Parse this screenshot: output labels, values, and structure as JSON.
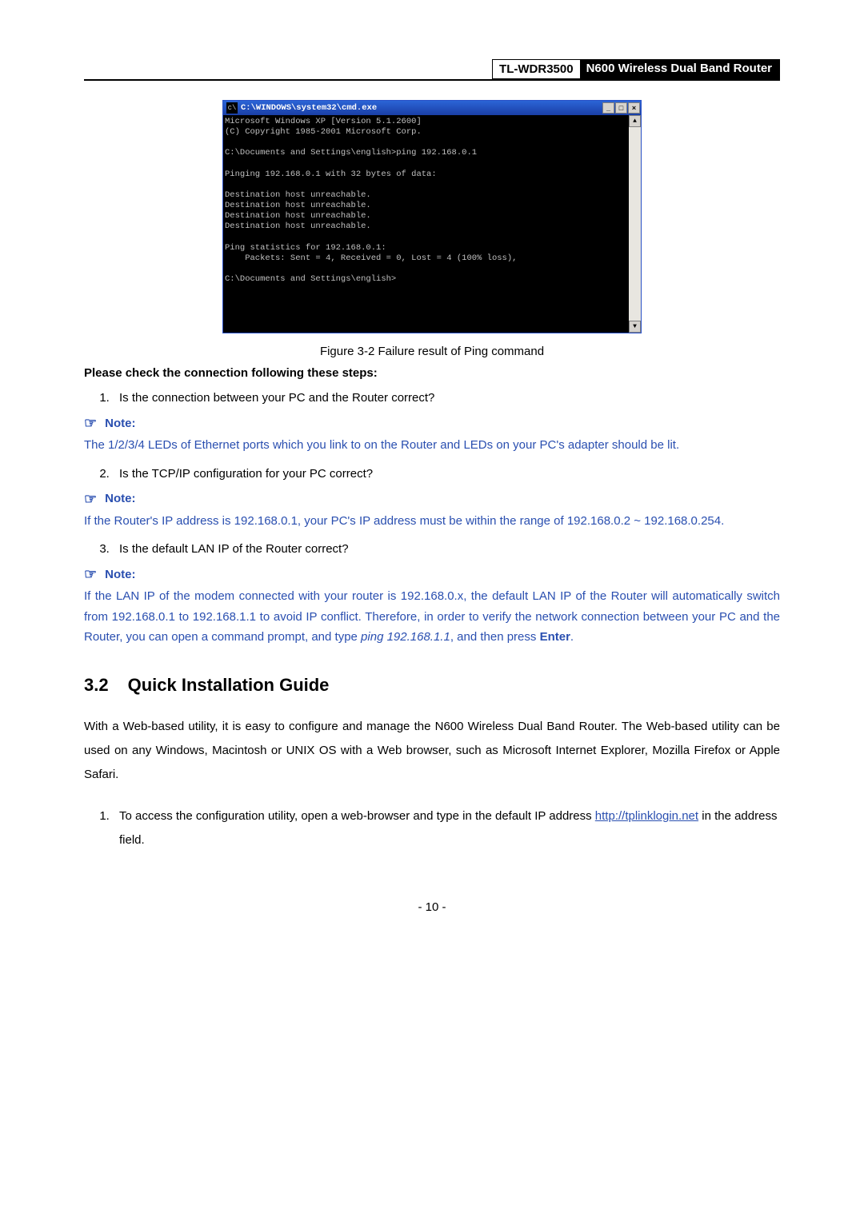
{
  "header": {
    "model": "TL-WDR3500",
    "product": "N600 Wireless Dual Band Router"
  },
  "cmd": {
    "title": "C:\\WINDOWS\\system32\\cmd.exe",
    "icon_glyph": "c\\",
    "min": "_",
    "max": "□",
    "close": "×",
    "up": "▲",
    "down": "▼",
    "body": "Microsoft Windows XP [Version 5.1.2600]\n(C) Copyright 1985-2001 Microsoft Corp.\n\nC:\\Documents and Settings\\english>ping 192.168.0.1\n\nPinging 192.168.0.1 with 32 bytes of data:\n\nDestination host unreachable.\nDestination host unreachable.\nDestination host unreachable.\nDestination host unreachable.\n\nPing statistics for 192.168.0.1:\n    Packets: Sent = 4, Received = 0, Lost = 4 (100% loss),\n\nC:\\Documents and Settings\\english>"
  },
  "figure_caption": "Figure 3-2 Failure result of Ping command",
  "check_heading": "Please check the connection following these steps:",
  "step1": "Is the connection between your PC and the Router correct?",
  "step2": "Is the TCP/IP configuration for your PC correct?",
  "step3": "Is the default LAN IP of the Router correct?",
  "note_label": "Note:",
  "note1_body": "The 1/2/3/4 LEDs of Ethernet ports which you link to on the Router and LEDs on your PC's adapter should be lit.",
  "note2_body": "If the Router's IP address is 192.168.0.1, your PC's IP address must be within the range of 192.168.0.2 ~ 192.168.0.254.",
  "note3_prefix": "If the LAN IP of the modem connected with your router is 192.168.0.x, the default LAN IP of the Router will automatically switch from 192.168.0.1 to 192.168.1.1 to avoid IP conflict. Therefore, in order to verify the network connection between your PC and the Router, you can open a command prompt, and type ",
  "note3_cmd": "ping 192.168.1.1",
  "note3_mid": ", and then press ",
  "note3_enter": "Enter",
  "note3_suffix": ".",
  "section": {
    "num": "3.2",
    "title": "Quick Installation Guide"
  },
  "intro_para": "With a Web-based utility, it is easy to configure and manage the N600 Wireless Dual Band Router. The Web-based utility can be used on any Windows, Macintosh or UNIX OS with a Web browser, such as Microsoft Internet Explorer, Mozilla Firefox or Apple Safari.",
  "qig1_prefix": "To access the configuration utility, open a web-browser and type in the default IP address ",
  "qig1_link": "http://tplinklogin.net",
  "qig1_suffix": " in the address field.",
  "page_number": "- 10 -"
}
